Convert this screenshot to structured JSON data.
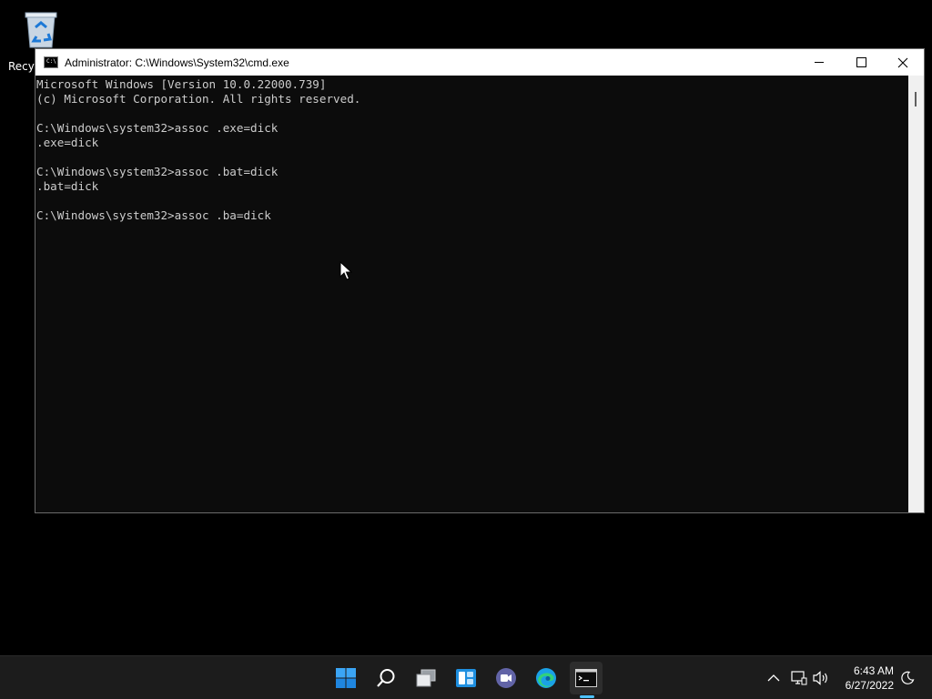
{
  "desktop": {
    "recycle_bin_label": "Recyc"
  },
  "window": {
    "title": "Administrator: C:\\Windows\\System32\\cmd.exe",
    "app_icon_text": "C:\\",
    "console_lines": [
      "Microsoft Windows [Version 10.0.22000.739]",
      "(c) Microsoft Corporation. All rights reserved.",
      "",
      "C:\\Windows\\system32>assoc .exe=dick",
      ".exe=dick",
      "",
      "C:\\Windows\\system32>assoc .bat=dick",
      ".bat=dick",
      "",
      "C:\\Windows\\system32>assoc .ba=dick"
    ]
  },
  "taskbar": {
    "apps": [
      {
        "name": "start-icon",
        "active": false
      },
      {
        "name": "search-icon",
        "active": false
      },
      {
        "name": "task-view-icon",
        "active": false
      },
      {
        "name": "widgets-icon",
        "active": false
      },
      {
        "name": "teams-chat-icon",
        "active": false
      },
      {
        "name": "edge-icon",
        "active": false
      },
      {
        "name": "command-prompt-icon",
        "active": true
      }
    ],
    "tray_icons": [
      "chevron-up-icon",
      "network-icon",
      "volume-icon",
      "focus-assist-icon"
    ],
    "clock": {
      "time": "6:43 AM",
      "date": "6/27/2022"
    }
  },
  "colors": {
    "console_bg": "#0c0c0c",
    "console_text": "#cccccc",
    "taskbar_bg": "#1c1c1c",
    "accent": "#4cc2ff"
  }
}
